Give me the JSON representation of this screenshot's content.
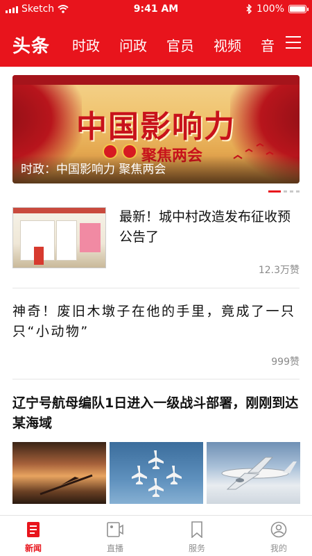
{
  "status_bar": {
    "carrier": "Sketch",
    "time": "9:41 AM",
    "battery": "100%"
  },
  "header": {
    "brand": "头条",
    "tabs": [
      "时政",
      "问政",
      "官员",
      "视频",
      "音"
    ],
    "menu_icon": "hamburger-menu-icon"
  },
  "banner": {
    "headline_art": "中国影响力",
    "sub_art": "聚焦两会",
    "caption": "时政：中国影响力 聚焦两会",
    "page_count": 4,
    "active_page": 1
  },
  "articles": [
    {
      "title": "最新！城中村改造发布征收预公告了",
      "likes": "12.3万赞",
      "image": "notice-board-photo"
    },
    {
      "title": "神奇！废旧木墩子在他的手里，竟成了一只只“小动物”",
      "likes": "999赞"
    },
    {
      "title": "辽宁号航母编队1日进入一级战斗部署，刚刚到达某海域",
      "images": [
        "glider-sunset-photo",
        "jet-formation-photo",
        "airliner-clouds-photo"
      ]
    }
  ],
  "tabbar": {
    "items": [
      {
        "label": "新闻",
        "icon": "news-icon",
        "active": true
      },
      {
        "label": "直播",
        "icon": "live-video-icon",
        "active": false
      },
      {
        "label": "服务",
        "icon": "bookmark-icon",
        "active": false
      },
      {
        "label": "我的",
        "icon": "profile-icon",
        "active": false
      }
    ]
  },
  "colors": {
    "brand_red": "#e8141c",
    "text_primary": "#111111",
    "text_muted": "#8a8a8a"
  }
}
